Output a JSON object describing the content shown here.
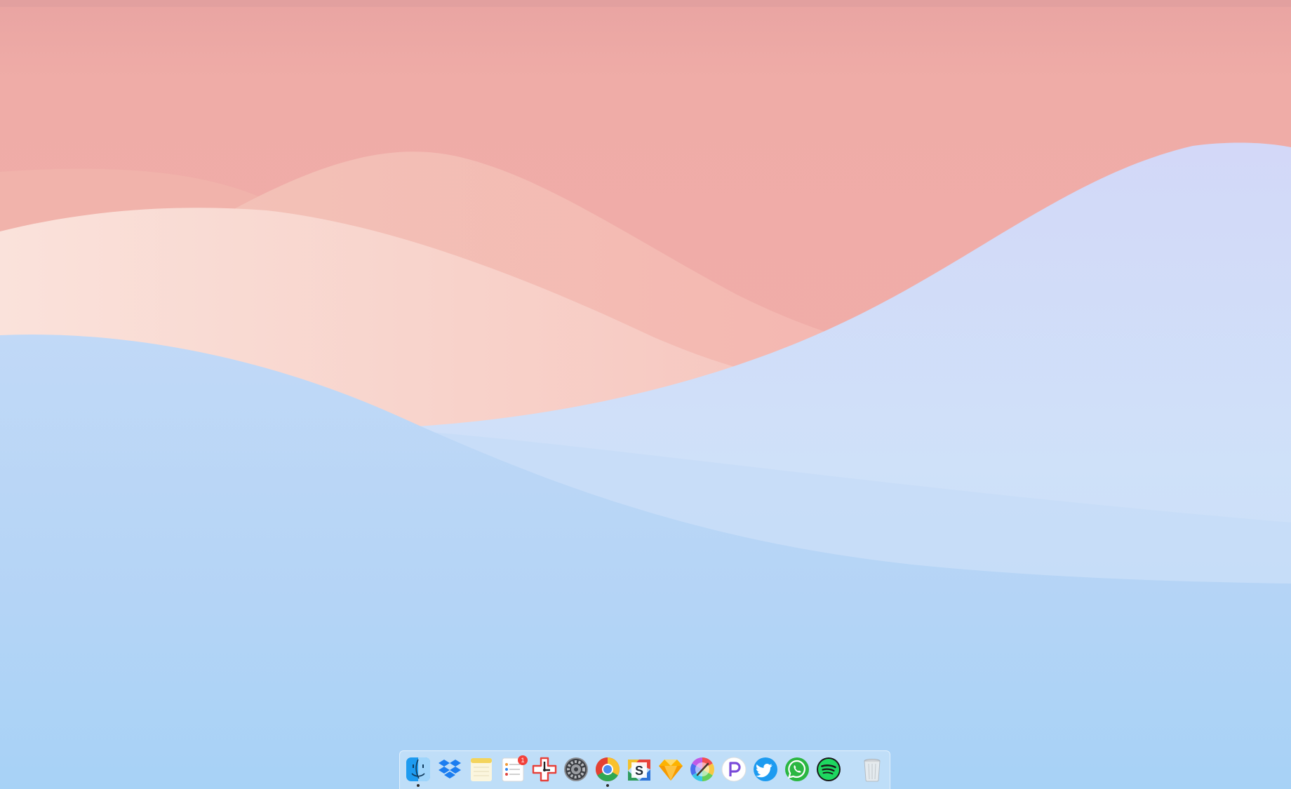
{
  "screen": {
    "kind": "macOS desktop",
    "wallpaper": {
      "name": "pastel-waves",
      "colors": {
        "pink_top": "#efa7a4",
        "pink_mid": "#f3bab3",
        "peach_light": "#f9d8d2",
        "blue_light": "#cfe0f9",
        "blue_mid": "#bcd7f6",
        "blue_bottom": "#a9d3f6"
      }
    }
  },
  "dock": {
    "apps": [
      {
        "id": "finder",
        "icon": "finder-icon",
        "running": true
      },
      {
        "id": "dropbox",
        "icon": "dropbox-icon",
        "running": false
      },
      {
        "id": "notes",
        "icon": "notes-icon",
        "running": false
      },
      {
        "id": "reminders",
        "icon": "reminders-icon",
        "running": false,
        "badge": "1"
      },
      {
        "id": "timing",
        "icon": "clock-plus-icon",
        "running": false
      },
      {
        "id": "system-preferences",
        "icon": "gear-icon",
        "running": false
      },
      {
        "id": "chrome",
        "icon": "chrome-icon",
        "running": true
      },
      {
        "id": "slides",
        "icon": "slides-s-icon",
        "running": false
      },
      {
        "id": "sketch",
        "icon": "sketch-diamond-icon",
        "running": false
      },
      {
        "id": "color-picker",
        "icon": "color-wheel-icon",
        "running": false
      },
      {
        "id": "pastebot",
        "icon": "p-circle-icon",
        "running": false
      },
      {
        "id": "twitter",
        "icon": "twitter-bird-icon",
        "running": false
      },
      {
        "id": "whatsapp",
        "icon": "whatsapp-icon",
        "running": false
      },
      {
        "id": "spotify",
        "icon": "spotify-icon",
        "running": false
      }
    ],
    "trash": {
      "id": "trash",
      "icon": "trash-icon"
    },
    "badge_color": "#f2413a"
  }
}
